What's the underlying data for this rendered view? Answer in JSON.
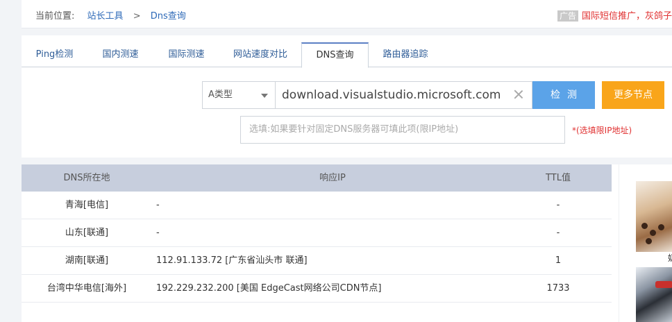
{
  "breadcrumb": {
    "prefix": "当前位置:",
    "items": [
      "站长工具",
      "Dns查询"
    ],
    "separator": ">"
  },
  "ad": {
    "tag": "广告",
    "text": "国际短信推广，灰鸽子"
  },
  "tabs": [
    {
      "label": "Ping检测",
      "active": false
    },
    {
      "label": "国内测速",
      "active": false
    },
    {
      "label": "国际测速",
      "active": false
    },
    {
      "label": "网站速度对比",
      "active": false
    },
    {
      "label": "DNS查询",
      "active": true
    },
    {
      "label": "路由器追踪",
      "active": false
    }
  ],
  "form": {
    "record_type": "A类型",
    "domain_value": "download.visualstudio.microsoft.com",
    "check_button": "检测",
    "more_nodes_button": "更多节点",
    "dns_server_placeholder": "选填:如果要针对固定DNS服务器可填此项(限IP地址)",
    "dns_server_hint": "*(选填限IP地址)"
  },
  "table": {
    "headers": {
      "location": "DNS所在地",
      "ip": "响应IP",
      "ttl": "TTL值"
    },
    "rows": [
      {
        "location": "青海[电信]",
        "ip": "-",
        "ttl": "-"
      },
      {
        "location": "山东[联通]",
        "ip": "-",
        "ttl": "-"
      },
      {
        "location": "湖南[联通]",
        "ip": "112.91.133.72 [广东省汕头市 联通]",
        "ttl": "1"
      },
      {
        "location": "台湾中华电信[海外]",
        "ip": "192.229.232.200 [美国 EdgeCast网络公司CDN节点]",
        "ttl": "1733"
      }
    ]
  },
  "sidebar": {
    "caption": "奶"
  },
  "colors": {
    "accent_blue": "#5ba3e8",
    "accent_orange": "#f9a51a",
    "link_blue": "#2e6ab8",
    "hint_red": "#e03131",
    "table_header": "#c7cedd"
  }
}
